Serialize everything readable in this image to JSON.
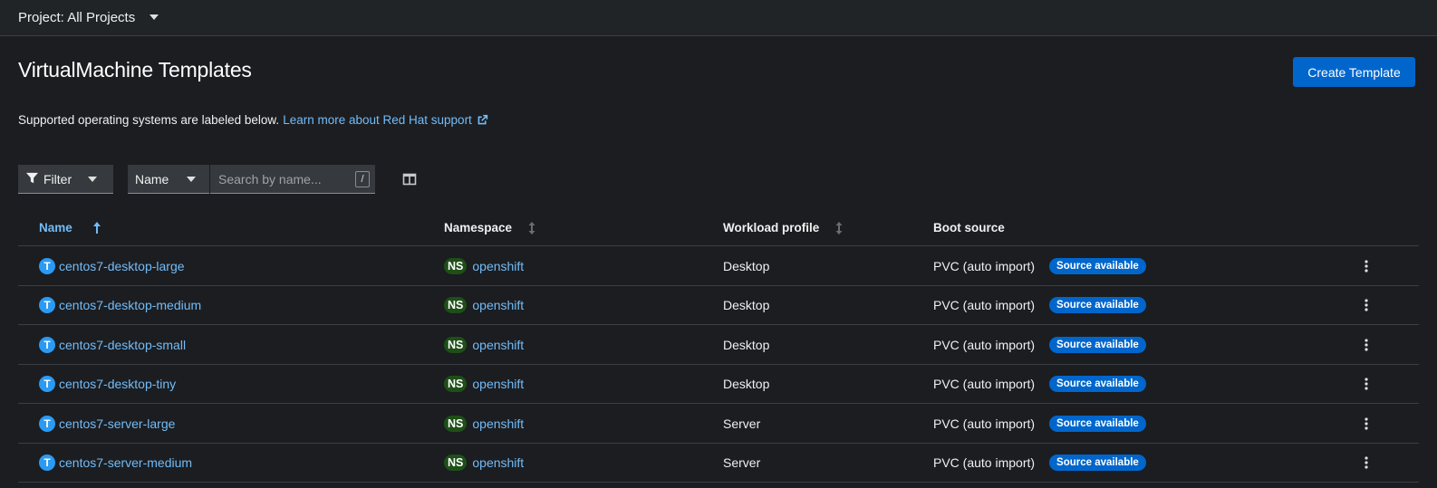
{
  "project_bar": {
    "label": "Project: All Projects",
    "dropdown_icon": "caret-down-icon"
  },
  "header": {
    "title": "VirtualMachine Templates",
    "create_button": "Create Template"
  },
  "support": {
    "text": "Supported operating systems are labeled below.",
    "link": "Learn more about Red Hat support",
    "link_icon": "external-link-icon"
  },
  "toolbar": {
    "filter_label": "Filter",
    "filter_icon": "filter-icon",
    "attribute_select": "Name",
    "search_placeholder": "Search by name...",
    "search_shortcut": "/",
    "columns_icon": "manage-columns-icon"
  },
  "table": {
    "columns": [
      {
        "label": "Name",
        "sort": "ascending"
      },
      {
        "label": "Namespace",
        "sort": "sortable"
      },
      {
        "label": "Workload profile",
        "sort": "sortable"
      },
      {
        "label": "Boot source",
        "sort": "none"
      }
    ],
    "rows": [
      {
        "badge": "T",
        "name": "centos7-desktop-large",
        "ns_badge": "NS",
        "namespace": "openshift",
        "workload": "Desktop",
        "boot_source": "PVC (auto import)",
        "status": "Source available"
      },
      {
        "badge": "T",
        "name": "centos7-desktop-medium",
        "ns_badge": "NS",
        "namespace": "openshift",
        "workload": "Desktop",
        "boot_source": "PVC (auto import)",
        "status": "Source available"
      },
      {
        "badge": "T",
        "name": "centos7-desktop-small",
        "ns_badge": "NS",
        "namespace": "openshift",
        "workload": "Desktop",
        "boot_source": "PVC (auto import)",
        "status": "Source available"
      },
      {
        "badge": "T",
        "name": "centos7-desktop-tiny",
        "ns_badge": "NS",
        "namespace": "openshift",
        "workload": "Desktop",
        "boot_source": "PVC (auto import)",
        "status": "Source available"
      },
      {
        "badge": "T",
        "name": "centos7-server-large",
        "ns_badge": "NS",
        "namespace": "openshift",
        "workload": "Server",
        "boot_source": "PVC (auto import)",
        "status": "Source available"
      },
      {
        "badge": "T",
        "name": "centos7-server-medium",
        "ns_badge": "NS",
        "namespace": "openshift",
        "workload": "Server",
        "boot_source": "PVC (auto import)",
        "status": "Source available"
      }
    ]
  },
  "colors": {
    "background": "#1b1d21",
    "topbar": "#212427",
    "link": "#73bcf7",
    "primary": "#0066cc",
    "template_badge": "#2b9af3",
    "namespace_badge": "#1e4f18"
  }
}
